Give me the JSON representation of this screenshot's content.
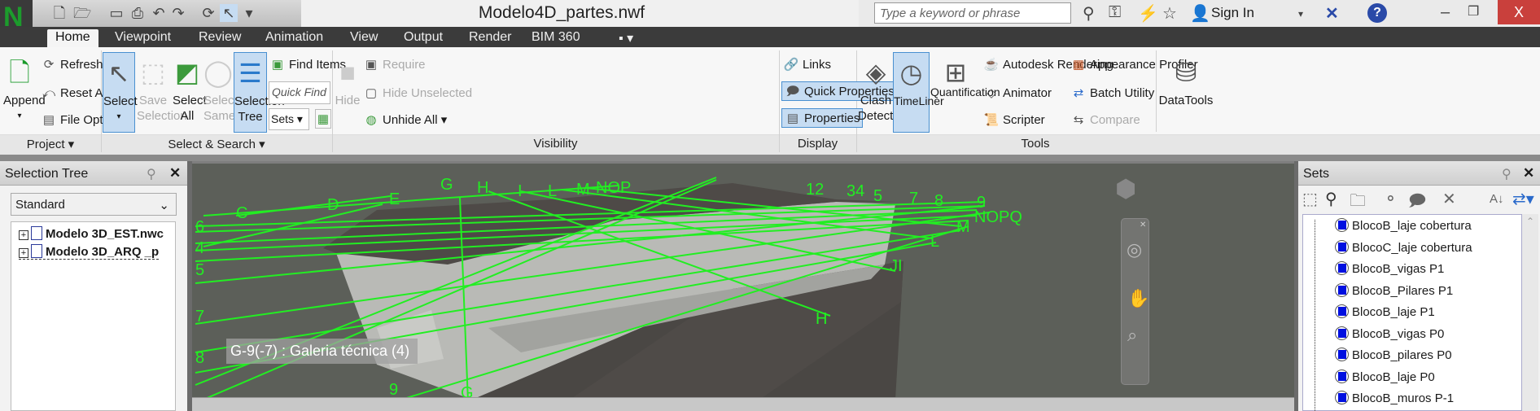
{
  "app": {
    "logo": "N",
    "title": "Modelo4D_partes.nwf"
  },
  "topbar": {
    "search_placeholder": "Type a keyword or phrase",
    "sign_in": "Sign In",
    "help": "?",
    "close": "X"
  },
  "tabs": [
    "Home",
    "Viewpoint",
    "Review",
    "Animation",
    "View",
    "Output",
    "Render",
    "BIM 360"
  ],
  "ribbon": {
    "project": {
      "label": "Project ▾",
      "append": "Append",
      "refresh": "Refresh",
      "reset_all": "Reset All... ▾",
      "file_options": "File Options"
    },
    "select_search": {
      "label": "Select & Search ▾",
      "select": "Select",
      "select_caret": "▾",
      "save_selection": "Save Selection",
      "select_all": "Select All",
      "select_same": "Select Same",
      "selection_tree": "Selection Tree",
      "find_items": "Find Items",
      "quick_find_placeholder": "Quick Find",
      "sets": "Sets"
    },
    "visibility": {
      "label": "Visibility",
      "hide": "Hide",
      "require": "Require",
      "hide_unselected": "Hide Unselected",
      "unhide_all": "Unhide All ▾"
    },
    "display": {
      "label": "Display",
      "links": "Links",
      "quick_properties": "Quick Properties",
      "properties": "Properties"
    },
    "tools": {
      "label": "Tools",
      "clash_detective": "Clash Detective",
      "timeliner": "TimeLiner",
      "quantification": "Quantification",
      "autodesk_rendering": "Autodesk Rendering",
      "animator": "Animator",
      "scripter": "Scripter",
      "appearance_profiler": "Appearance Profiler",
      "batch_utility": "Batch Utility",
      "compare": "Compare"
    },
    "datatools": "DataTools"
  },
  "selection_tree": {
    "title": "Selection Tree",
    "mode": "Standard",
    "items": [
      "Modelo 3D_EST.nwc",
      "Modelo 3D_ARQ _p"
    ]
  },
  "viewport": {
    "tooltip": "G-9(-7) : Galeria técnica (4)",
    "grid_color": "#22ee22",
    "grid_labels": [
      "G",
      "H",
      "I",
      "L",
      "M",
      "NOP",
      "C",
      "D",
      "E",
      "6",
      "4",
      "5",
      "7",
      "8",
      "9",
      "G",
      "12",
      "34",
      "5",
      "7",
      "8",
      "9",
      "NOPQ",
      "M",
      "L",
      "JI",
      "H"
    ]
  },
  "sets": {
    "title": "Sets",
    "items": [
      "BlocoB_laje cobertura",
      "BlocoC_laje cobertura",
      "BlocoB_vigas P1",
      "BlocoB_Pilares P1",
      "BlocoB_laje P1",
      "BlocoB_vigas P0",
      "BlocoB_pilares P0",
      "BlocoB_laje P0",
      "BlocoB_muros P-1"
    ],
    "item_color": "#0010e0"
  }
}
